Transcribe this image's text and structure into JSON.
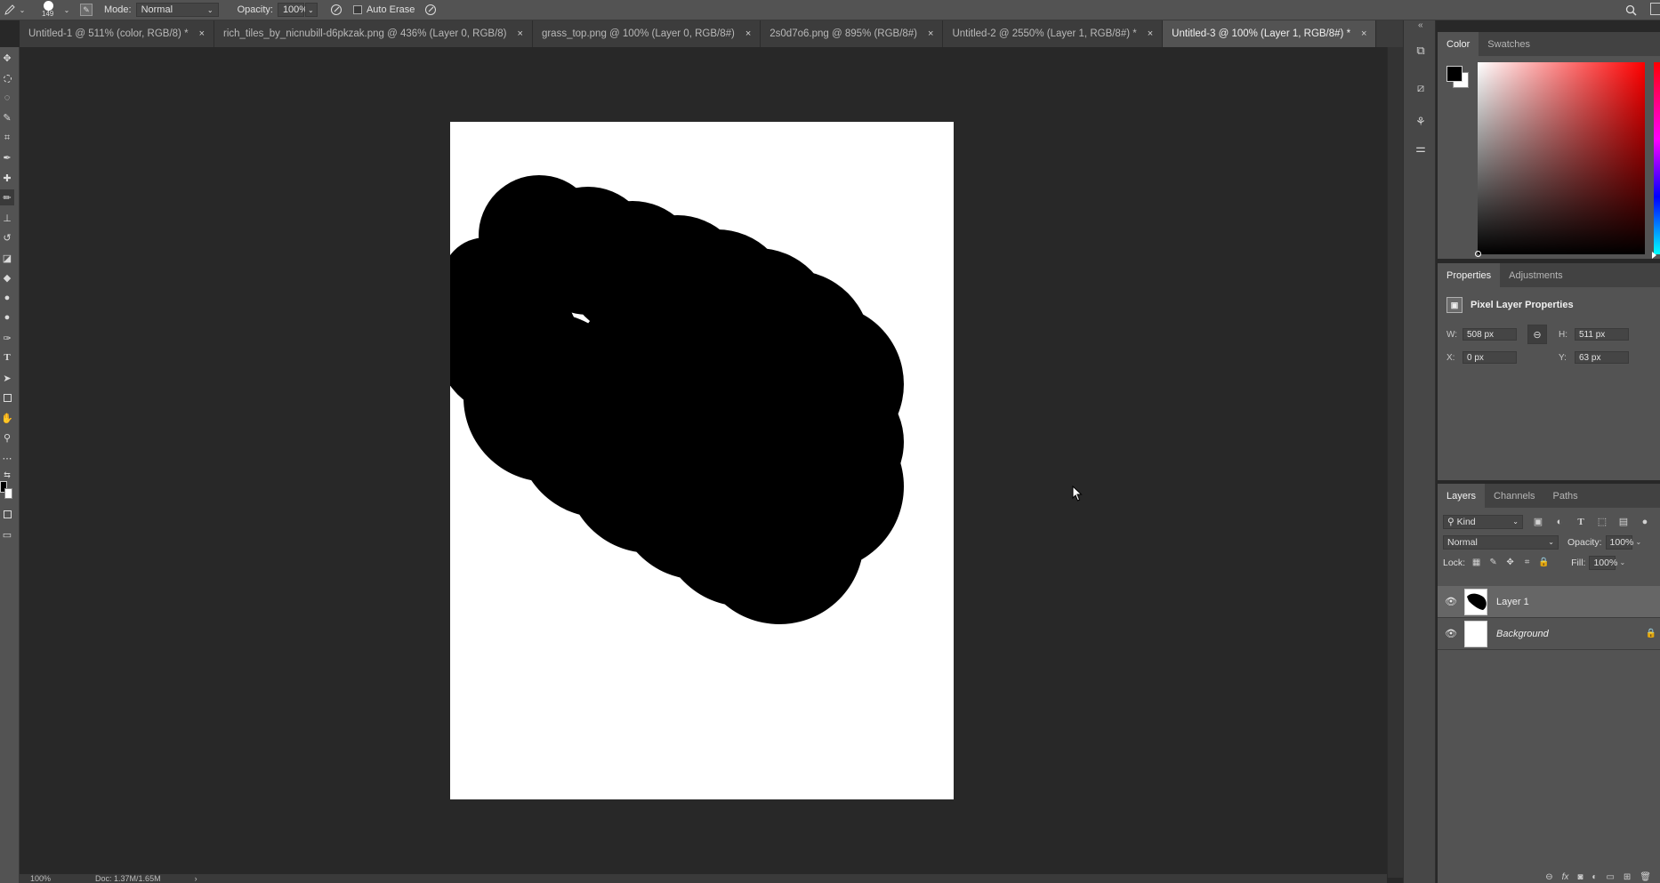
{
  "options_bar": {
    "brush_size": "149",
    "mode_label": "Mode:",
    "mode_value": "Normal",
    "opacity_label": "Opacity:",
    "opacity_value": "100%",
    "auto_erase_label": "Auto Erase"
  },
  "tabs": [
    {
      "label": "Untitled-1 @ 511% (color, RGB/8) *",
      "active": false
    },
    {
      "label": "rich_tiles_by_nicnubill-d6pkzak.png @ 436% (Layer 0, RGB/8)",
      "active": false
    },
    {
      "label": "grass_top.png @ 100% (Layer 0, RGB/8#)",
      "active": false
    },
    {
      "label": "2s0d7o6.png @ 895% (RGB/8#)",
      "active": false
    },
    {
      "label": "Untitled-2 @ 2550% (Layer 1, RGB/8#) *",
      "active": false
    },
    {
      "label": "Untitled-3 @ 100% (Layer 1, RGB/8#) *",
      "active": true
    }
  ],
  "tab_close_glyph": "×",
  "status": {
    "zoom": "100%",
    "doc": "Doc: 1.37M/1.65M"
  },
  "color_panel": {
    "tabs": [
      "Color",
      "Swatches"
    ]
  },
  "properties_panel": {
    "tabs": [
      "Properties",
      "Adjustments"
    ],
    "title": "Pixel Layer Properties",
    "w_label": "W:",
    "w_value": "508 px",
    "h_label": "H:",
    "h_value": "511 px",
    "x_label": "X:",
    "x_value": "0 px",
    "y_label": "Y:",
    "y_value": "63 px"
  },
  "layers_panel": {
    "tabs": [
      "Layers",
      "Channels",
      "Paths"
    ],
    "filter_kind": "Kind",
    "blend_mode": "Normal",
    "opacity_label": "Opacity:",
    "opacity_value": "100%",
    "lock_label": "Lock:",
    "fill_label": "Fill:",
    "fill_value": "100%",
    "layers": [
      {
        "name": "Layer 1",
        "selected": true,
        "italic": false
      },
      {
        "name": "Background",
        "selected": false,
        "italic": true
      }
    ],
    "footer_fx": "fx"
  },
  "colors": {
    "foreground": "#000000",
    "background": "#ffffff",
    "ui_dark": "#282828",
    "ui_panel": "#535353"
  }
}
